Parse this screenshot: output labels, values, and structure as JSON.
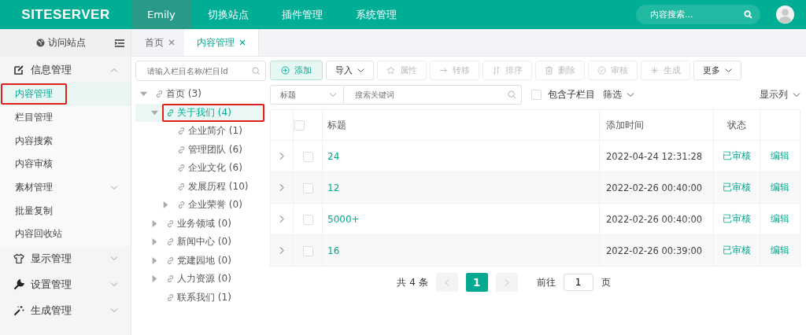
{
  "topbar": {
    "logo": "SITESERVER",
    "nav": [
      {
        "label": "Emily",
        "selected": true
      },
      {
        "label": "切换站点",
        "selected": false
      },
      {
        "label": "插件管理",
        "selected": false
      },
      {
        "label": "系统管理",
        "selected": false
      }
    ],
    "search": {
      "placeholder": "内容搜索..."
    }
  },
  "sidebar": {
    "visit": "访问站点",
    "groups": [
      {
        "label": "信息管理",
        "expanded": true,
        "items": [
          {
            "label": "内容管理",
            "kind": "item",
            "selected": true,
            "highlighted": true
          },
          {
            "label": "栏目管理",
            "kind": "item",
            "selected": false,
            "highlighted": false
          },
          {
            "label": "内容搜索",
            "kind": "item",
            "selected": false,
            "highlighted": false
          },
          {
            "label": "内容审核",
            "kind": "item",
            "selected": false,
            "highlighted": false
          },
          {
            "label": "素材管理",
            "kind": "submenu",
            "selected": false,
            "highlighted": false
          },
          {
            "label": "批量复制",
            "kind": "item",
            "selected": false,
            "highlighted": false
          },
          {
            "label": "内容回收站",
            "kind": "item",
            "selected": false,
            "highlighted": false
          }
        ]
      },
      {
        "label": "显示管理",
        "expanded": false
      },
      {
        "label": "设置管理",
        "expanded": false
      },
      {
        "label": "生成管理",
        "expanded": false
      }
    ]
  },
  "tabs": [
    {
      "label": "首页",
      "selected": false
    },
    {
      "label": "内容管理",
      "selected": true
    }
  ],
  "tree": {
    "search": {
      "placeholder": "请输入栏目名称/栏目Id"
    },
    "nodes": [
      {
        "label": "首页 (3)",
        "kind": "branch",
        "expanded": true,
        "selected": false,
        "highlighted": false,
        "children": [
          {
            "label": "关于我们 (4)",
            "kind": "branch",
            "expanded": true,
            "selected": true,
            "highlighted": true,
            "children": [
              {
                "label": "企业简介 (1)",
                "kind": "leaf",
                "selected": false,
                "highlighted": false
              },
              {
                "label": "管理团队 (6)",
                "kind": "leaf",
                "selected": false,
                "highlighted": false
              },
              {
                "label": "企业文化 (6)",
                "kind": "leaf",
                "selected": false,
                "highlighted": false
              },
              {
                "label": "发展历程 (10)",
                "kind": "leaf",
                "selected": false,
                "highlighted": false
              },
              {
                "label": "企业荣誉 (0)",
                "kind": "branch",
                "expanded": false,
                "selected": false,
                "highlighted": false
              }
            ]
          },
          {
            "label": "业务领域 (0)",
            "kind": "branch",
            "expanded": false,
            "selected": false,
            "highlighted": false
          },
          {
            "label": "新闻中心 (0)",
            "kind": "branch",
            "expanded": false,
            "selected": false,
            "highlighted": false
          },
          {
            "label": "党建园地 (0)",
            "kind": "branch",
            "expanded": false,
            "selected": false,
            "highlighted": false
          },
          {
            "label": "人力资源 (0)",
            "kind": "branch",
            "expanded": false,
            "selected": false,
            "highlighted": false
          },
          {
            "label": "联系我们 (1)",
            "kind": "leaf",
            "selected": false,
            "highlighted": false
          }
        ]
      }
    ]
  },
  "toolbar": [
    {
      "label": "添加",
      "kind": "primary",
      "disabled": false
    },
    {
      "label": "导入",
      "kind": "dropdown",
      "disabled": false
    },
    {
      "label": "属性",
      "kind": "plain",
      "disabled": true
    },
    {
      "label": "转移",
      "kind": "plain",
      "disabled": true
    },
    {
      "label": "排序",
      "kind": "plain",
      "disabled": true
    },
    {
      "label": "删除",
      "kind": "plain",
      "disabled": true
    },
    {
      "label": "审核",
      "kind": "plain",
      "disabled": true
    },
    {
      "label": "生成",
      "kind": "plain",
      "disabled": true
    },
    {
      "label": "更多",
      "kind": "dropdown",
      "disabled": false
    }
  ],
  "filter": {
    "field": "标题",
    "placeholder": "搜索关键词",
    "include_children": {
      "label": "包含子栏目",
      "checked": false
    },
    "screen": "筛选",
    "columns": "显示列"
  },
  "table": {
    "columns": [
      "标题",
      "添加时间",
      "状态"
    ],
    "all_checked": false,
    "rows": [
      {
        "title": "24",
        "time": "2022-04-24 12:31:28",
        "status": "已审核",
        "action": "编辑",
        "checked": false
      },
      {
        "title": "12",
        "time": "2022-02-26 00:40:00",
        "status": "已审核",
        "action": "编辑",
        "checked": false
      },
      {
        "title": "5000+",
        "time": "2022-02-26 00:40:00",
        "status": "已审核",
        "action": "编辑",
        "checked": false
      },
      {
        "title": "16",
        "time": "2022-02-26 00:39:00",
        "status": "已审核",
        "action": "编辑",
        "checked": false
      }
    ]
  },
  "pagination": {
    "total": "共 4 条",
    "pages": [
      {
        "label": "1",
        "selected": true
      }
    ],
    "goto": "前往",
    "page_value": "1",
    "page_unit": "页"
  }
}
